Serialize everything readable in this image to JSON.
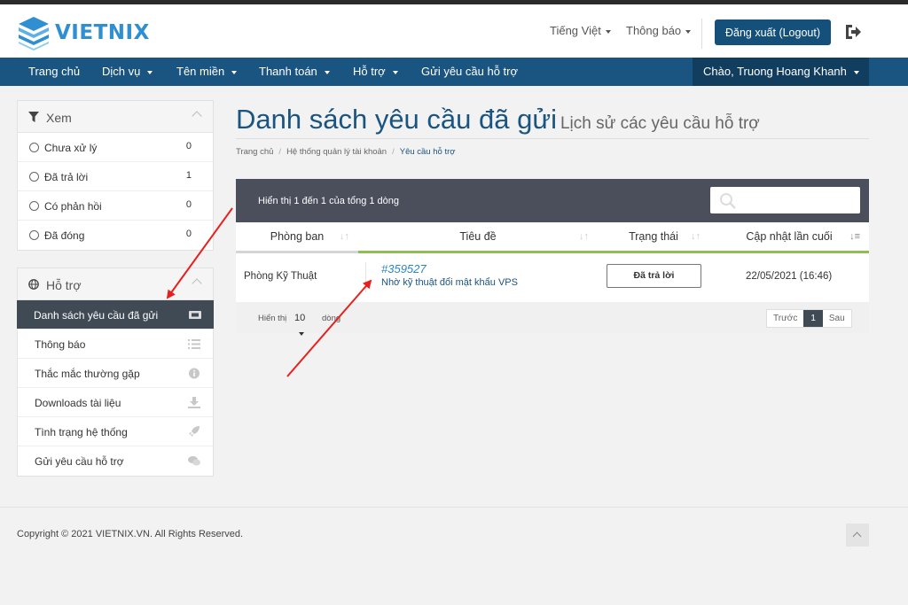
{
  "brand": {
    "name": "VIETNIX",
    "color": "#2f8fd1"
  },
  "header": {
    "language": "Tiếng Việt",
    "notifications": "Thông báo",
    "logout_label": "Đăng xuất (Logout)",
    "exit_icon": "sign-out-icon"
  },
  "nav": {
    "items": [
      {
        "label": "Trang chủ",
        "dropdown": false
      },
      {
        "label": "Dịch vụ",
        "dropdown": true
      },
      {
        "label": "Tên miền",
        "dropdown": true
      },
      {
        "label": "Thanh toán",
        "dropdown": true
      },
      {
        "label": "Hỗ trợ",
        "dropdown": true
      },
      {
        "label": "Gửi yêu cầu hỗ trợ",
        "dropdown": false
      }
    ],
    "user": "Chào, Truong Hoang Khanh",
    "color": "#1a5480"
  },
  "sidebar": {
    "filter": {
      "title": "Xem",
      "icon": "filter-icon",
      "items": [
        {
          "label": "Chưa xử lý",
          "count": "0"
        },
        {
          "label": "Đã trả lời",
          "count": "1"
        },
        {
          "label": "Có phản hồi",
          "count": "0"
        },
        {
          "label": "Đã đóng",
          "count": "0"
        }
      ]
    },
    "support": {
      "title": "Hỗ trợ",
      "icon": "globe-icon",
      "items": [
        {
          "label": "Danh sách yêu cầu đã gửi",
          "icon": "ticket-icon",
          "active": true
        },
        {
          "label": "Thông báo",
          "icon": "list-icon",
          "active": false
        },
        {
          "label": "Thắc mắc thường gặp",
          "icon": "info-icon",
          "active": false
        },
        {
          "label": "Downloads tài liệu",
          "icon": "download-icon",
          "active": false
        },
        {
          "label": "Tình trạng hệ thống",
          "icon": "rocket-icon",
          "active": false
        },
        {
          "label": "Gửi yêu cầu hỗ trợ",
          "icon": "comments-icon",
          "active": false
        }
      ]
    }
  },
  "main": {
    "title": "Danh sách yêu cầu đã gửi",
    "subtitle": "Lịch sử các yêu cầu hỗ trợ",
    "breadcrumb": [
      "Trang chủ",
      "Hệ thống quản lý tài khoản",
      "Yêu cầu hỗ trợ"
    ],
    "table": {
      "info": "Hiển thị 1 đến 1 của tổng 1 dòng",
      "search_placeholder": "",
      "columns": [
        "Phòng ban",
        "Tiêu đề",
        "Trạng thái",
        "Cập nhật lần cuối"
      ],
      "rows": [
        {
          "department": "Phòng Kỹ Thuật",
          "ticket_id": "#359527",
          "subject": "Nhờ kỹ thuật đổi mật khẩu VPS",
          "status": "Đã trả lời",
          "updated": "22/05/2021 (16:46)"
        }
      ],
      "footer": {
        "show_label": "Hiển thị",
        "page_length": "10",
        "rows_label": "dòng",
        "prev": "Trước",
        "current_page": "1",
        "next": "Sau"
      },
      "accent_green": "#8cc152"
    }
  },
  "footer": {
    "copyright": "Copyright © 2021 VIETNIX.VN. All Rights Reserved."
  },
  "annotation_color": "#e8201d"
}
